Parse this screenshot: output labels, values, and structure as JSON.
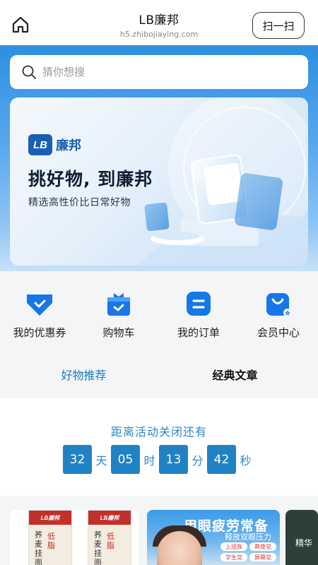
{
  "topbar": {
    "title": "LB廉邦",
    "url": "h5.zhibojiaying.com",
    "scan_label": "扫一扫"
  },
  "search": {
    "placeholder": "猜你想搜"
  },
  "banner": {
    "logo_text": "LB",
    "logo_name": "廉邦",
    "headline": "挑好物, 到廉邦",
    "subline": "精选高性价比日常好物"
  },
  "categories": [
    {
      "label": "我的优惠券",
      "icon": "coupon-icon"
    },
    {
      "label": "购物车",
      "icon": "cart-bag-icon"
    },
    {
      "label": "我的订单",
      "icon": "order-icon"
    },
    {
      "label": "会员中心",
      "icon": "member-bag-icon"
    }
  ],
  "tabs": [
    {
      "label": "好物推荐",
      "active": true
    },
    {
      "label": "经典文章",
      "active": false
    }
  ],
  "countdown": {
    "title": "距离活动关闭还有",
    "days": "32",
    "days_unit": "天",
    "hours": "05",
    "hours_unit": "时",
    "minutes": "13",
    "minutes_unit": "分",
    "seconds": "42",
    "seconds_unit": "秒"
  },
  "products": {
    "p1": {
      "brand": "LB廉邦",
      "name_left": "荞麦挂面",
      "name_stamp": "低脂"
    },
    "p2": {
      "headline": "用眼疲劳常备",
      "subline": "释放双眼压力",
      "tags": [
        "上班族",
        "熬夜党",
        "学生党",
        "屏幕党"
      ]
    },
    "p3": {
      "text": "精华"
    }
  },
  "colors": {
    "accent": "#2082c4",
    "header_blue": "#2d8fe0",
    "icon_blue": "#1677e8"
  }
}
